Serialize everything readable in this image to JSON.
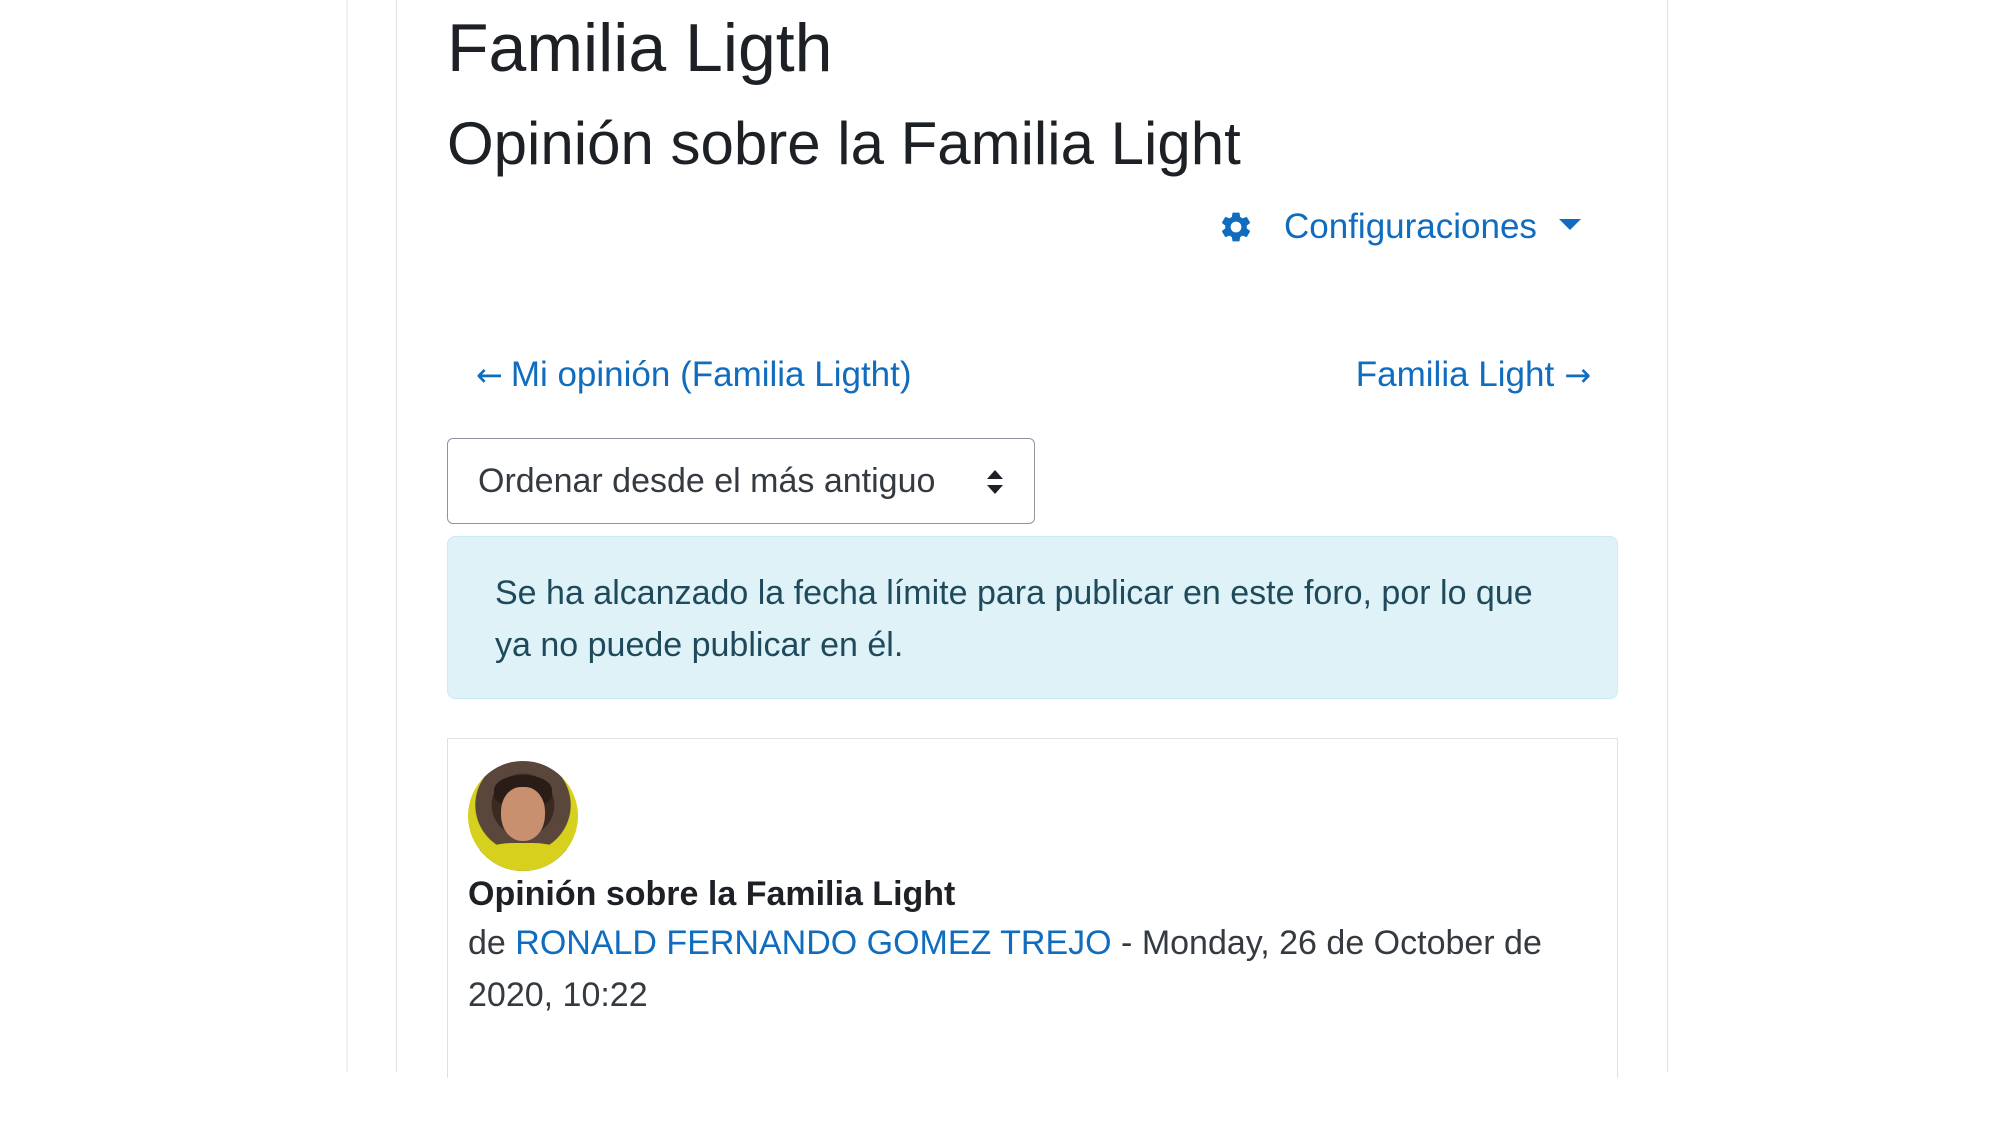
{
  "course": {
    "title": "Familia Ligth"
  },
  "forum": {
    "title": "Opinión sobre la Familia Light"
  },
  "settings_menu": {
    "label": "Configuraciones",
    "icon": "gear-icon",
    "accent_color": "#0f6cbf"
  },
  "navigation": {
    "prev": {
      "arrow": "←",
      "label": "Mi opinión (Familia Ligtht)"
    },
    "next": {
      "label": "Familia Light",
      "arrow": "→"
    }
  },
  "sort": {
    "selected": "Ordenar desde el más antiguo"
  },
  "notice": {
    "text": "Se ha alcanzado la fecha límite para publicar en este foro, por lo que ya no puede publicar en él."
  },
  "post": {
    "subject": "Opinión sobre la Familia Light",
    "by_prefix": "de",
    "author": "RONALD FERNANDO GOMEZ TREJO",
    "date_text": "- Monday, 26 de October de 2020, 10:22"
  },
  "colors": {
    "link": "#0f6cbf",
    "alert_bg": "#def2f8",
    "alert_text": "#1f4a5b"
  }
}
